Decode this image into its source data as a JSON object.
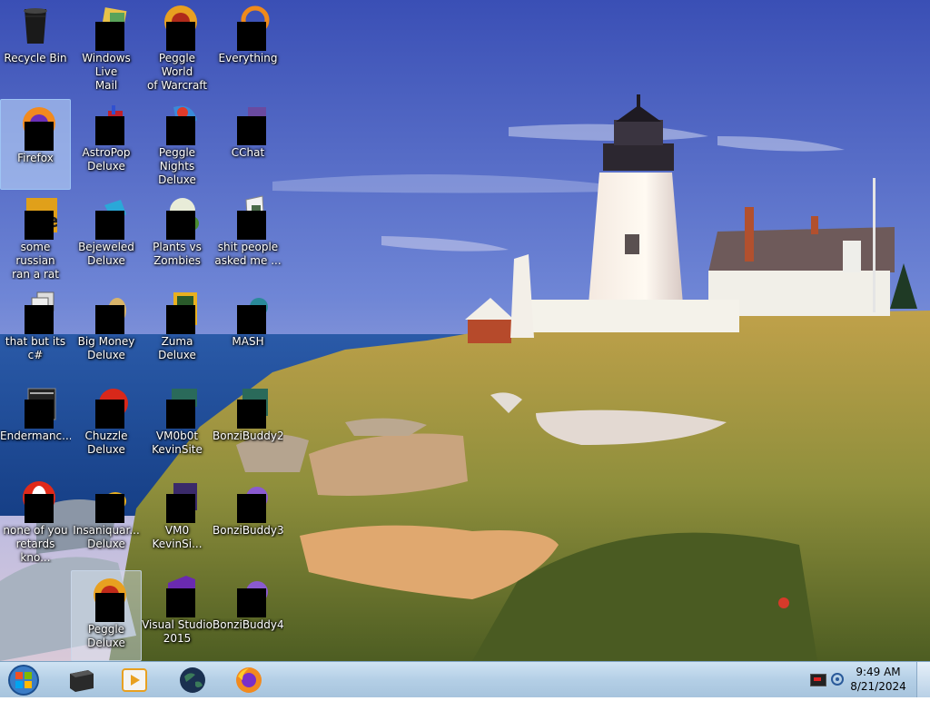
{
  "desktop": {
    "icons": [
      {
        "label": "Recycle Bin",
        "icon": "recycle-bin-icon"
      },
      {
        "label": "Windows Live\nMail",
        "icon": "windows-live-mail-icon"
      },
      {
        "label": "Peggle World\nof Warcraft ...",
        "icon": "peggle-wow-icon"
      },
      {
        "label": "Everything",
        "icon": "everything-search-icon"
      },
      {
        "label": "Firefox",
        "icon": "firefox-icon"
      },
      {
        "label": "AstroPop\nDeluxe",
        "icon": "astropop-icon"
      },
      {
        "label": "Peggle Nights\nDeluxe",
        "icon": "peggle-nights-icon"
      },
      {
        "label": "CChat",
        "icon": "cchat-icon"
      },
      {
        "label": "some russian\nran a rat",
        "icon": "dreamweaver-icon"
      },
      {
        "label": "Bejeweled\nDeluxe",
        "icon": "bejeweled-icon"
      },
      {
        "label": "Plants vs\nZombies",
        "icon": "plants-vs-zombies-icon"
      },
      {
        "label": "shit people\nasked me ...",
        "icon": "folder-icon"
      },
      {
        "label": "that but its c#",
        "icon": "stacked-windows-icon"
      },
      {
        "label": "Big Money\nDeluxe",
        "icon": "big-money-icon"
      },
      {
        "label": "Zuma Deluxe",
        "icon": "zuma-icon"
      },
      {
        "label": "MASH",
        "icon": "mash-icon"
      },
      {
        "label": "Endermanc...",
        "icon": "terminal-icon"
      },
      {
        "label": "Chuzzle\nDeluxe",
        "icon": "chuzzle-icon"
      },
      {
        "label": "VM0b0t\nKevinSite",
        "icon": "vm-icon"
      },
      {
        "label": "BonziBuddy2",
        "icon": "bonzibuddy-icon"
      },
      {
        "label": "none of you\nretards kno...",
        "icon": "opera-icon"
      },
      {
        "label": "Insaniquar...\nDeluxe",
        "icon": "insaniquarium-icon"
      },
      {
        "label": "VM0\nKevinSi...",
        "icon": "vm-icon"
      },
      {
        "label": "BonziBuddy3",
        "icon": "bonzibuddy-icon"
      },
      {
        "label": "Peggle Deluxe",
        "icon": "peggle-deluxe-icon"
      },
      {
        "label": "Visual Studio\n2015",
        "icon": "visual-studio-icon"
      },
      {
        "label": "BonziBuddy4",
        "icon": "bonzibuddy-icon"
      }
    ]
  },
  "taskbar": {
    "pinned": [
      {
        "name": "terminal",
        "icon": "terminal-icon"
      },
      {
        "name": "media-player",
        "icon": "media-player-icon"
      },
      {
        "name": "globe",
        "icon": "globe-icon"
      },
      {
        "name": "firefox",
        "icon": "firefox-icon"
      }
    ],
    "clock": {
      "time": "9:49 AM",
      "date": "8/21/2024"
    }
  },
  "colors": {
    "sky_top": "#3b55b8",
    "sky_bottom": "#b9b9de",
    "sea": "#1f4f9c",
    "grass": "#9a8a3a",
    "taskbar": "#b4cfe6"
  }
}
